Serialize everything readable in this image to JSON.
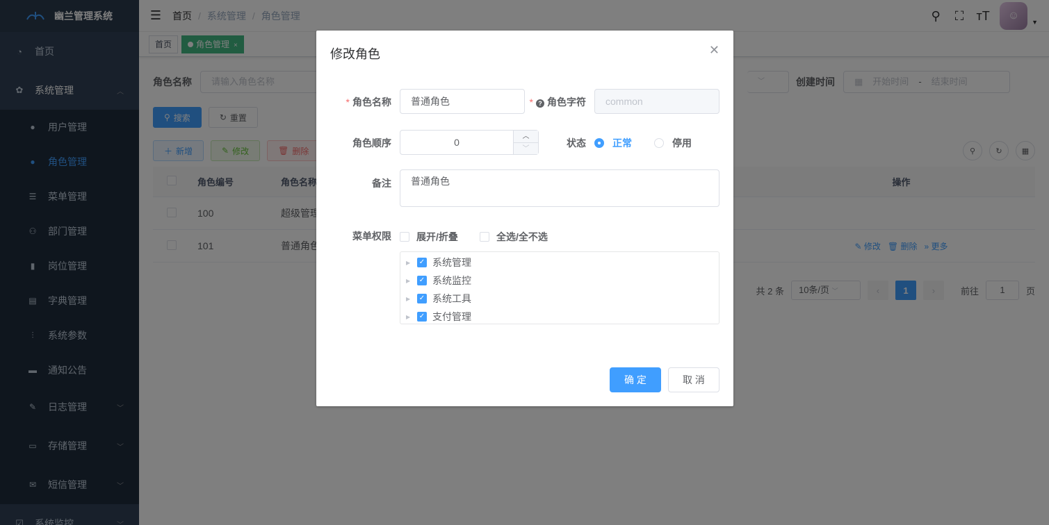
{
  "app": {
    "title": "幽兰管理系统"
  },
  "sidebar": {
    "home": "首页",
    "system": "系统管理",
    "sub_items": [
      {
        "label": "用户管理",
        "icon": "user-icon"
      },
      {
        "label": "角色管理",
        "icon": "peoples-icon",
        "active": true
      },
      {
        "label": "菜单管理",
        "icon": "tree-table-icon"
      },
      {
        "label": "部门管理",
        "icon": "tree-icon"
      },
      {
        "label": "岗位管理",
        "icon": "post-icon"
      },
      {
        "label": "字典管理",
        "icon": "dict-icon"
      },
      {
        "label": "系统参数",
        "icon": "edit-icon"
      },
      {
        "label": "通知公告",
        "icon": "message-icon"
      }
    ],
    "groups": [
      {
        "label": "日志管理",
        "icon": "log-icon"
      },
      {
        "label": "存储管理",
        "icon": "storage-icon"
      },
      {
        "label": "短信管理",
        "icon": "sms-icon"
      },
      {
        "label": "系统监控",
        "icon": "monitor-icon"
      }
    ]
  },
  "breadcrumb": [
    "首页",
    "系统管理",
    "角色管理"
  ],
  "tags": {
    "home": "首页",
    "current": "角色管理",
    "close": "×"
  },
  "search": {
    "role_name_label": "角色名称",
    "role_name_placeholder": "请输入角色名称",
    "created_label": "创建时间",
    "start_placeholder": "开始时间",
    "range_sep": "-",
    "end_placeholder": "结束时间",
    "search_btn": "搜索",
    "reset_btn": "重置"
  },
  "toolbar": {
    "add": "新增",
    "edit": "修改",
    "delete": "删除"
  },
  "table": {
    "headers": {
      "id": "角色编号",
      "name": "角色名称",
      "ops": "操作"
    },
    "rows": [
      {
        "id": "100",
        "name": "超级管理"
      },
      {
        "id": "101",
        "name": "普通角色"
      }
    ],
    "row_ops": {
      "edit": "修改",
      "delete": "删除",
      "more": "更多"
    }
  },
  "pagination": {
    "total": "共 2 条",
    "page_size": "10条/页",
    "current": "1",
    "goto_label": "前往",
    "goto_value": "1",
    "page_suffix": "页"
  },
  "dialog": {
    "title": "修改角色",
    "role_name_label": "角色名称",
    "role_name_value": "普通角色",
    "role_key_label": "角色字符",
    "role_key_value": "common",
    "order_label": "角色顺序",
    "order_value": "0",
    "status_label": "状态",
    "status_normal": "正常",
    "status_disabled": "停用",
    "remark_label": "备注",
    "remark_value": "普通角色",
    "menu_label": "菜单权限",
    "expand_option": "展开/折叠",
    "select_all_option": "全选/全不选",
    "tree": [
      "系统管理",
      "系统监控",
      "系统工具",
      "支付管理"
    ],
    "ok": "确 定",
    "cancel": "取 消"
  },
  "colors": {
    "primary": "#409eff",
    "sidebar": "#304156",
    "tag_active": "#42b983"
  }
}
